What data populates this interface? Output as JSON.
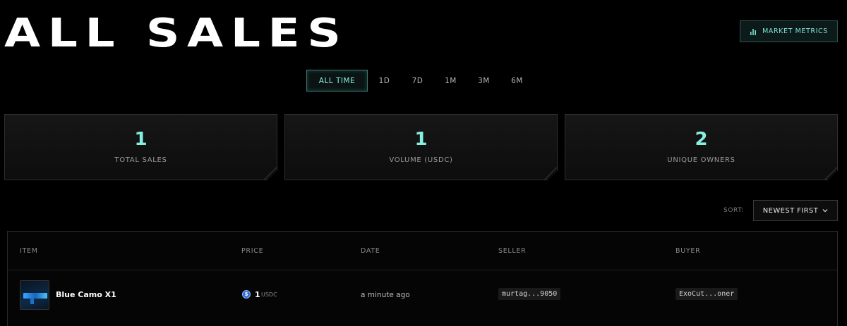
{
  "page": {
    "title": "ALL SALES"
  },
  "header": {
    "metrics_button_label": "MARKET METRICS",
    "metrics_icon": "bar-chart-icon"
  },
  "time_filters": [
    {
      "label": "ALL TIME",
      "active": true
    },
    {
      "label": "1D",
      "active": false
    },
    {
      "label": "7D",
      "active": false
    },
    {
      "label": "1M",
      "active": false
    },
    {
      "label": "3M",
      "active": false
    },
    {
      "label": "6M",
      "active": false
    }
  ],
  "stats": [
    {
      "value": "1",
      "label": "TOTAL SALES"
    },
    {
      "value": "1",
      "label": "VOLUME (USDC)"
    },
    {
      "value": "2",
      "label": "UNIQUE OWNERS"
    }
  ],
  "sort": {
    "label": "SORT:",
    "selected": "NEWEST FIRST"
  },
  "table": {
    "columns": [
      "ITEM",
      "PRICE",
      "DATE",
      "SELLER",
      "BUYER"
    ],
    "rows": [
      {
        "item": "Blue Camo X1",
        "price": "1",
        "currency": "USDC",
        "coin_symbol": "$",
        "date": "a minute ago",
        "seller": "murtag...9050",
        "buyer": "ExoCut...oner"
      }
    ]
  },
  "colors": {
    "accent": "#86efe0",
    "background": "#000000",
    "card_border": "#2e2e2e",
    "coin": "#2f6fd6"
  }
}
